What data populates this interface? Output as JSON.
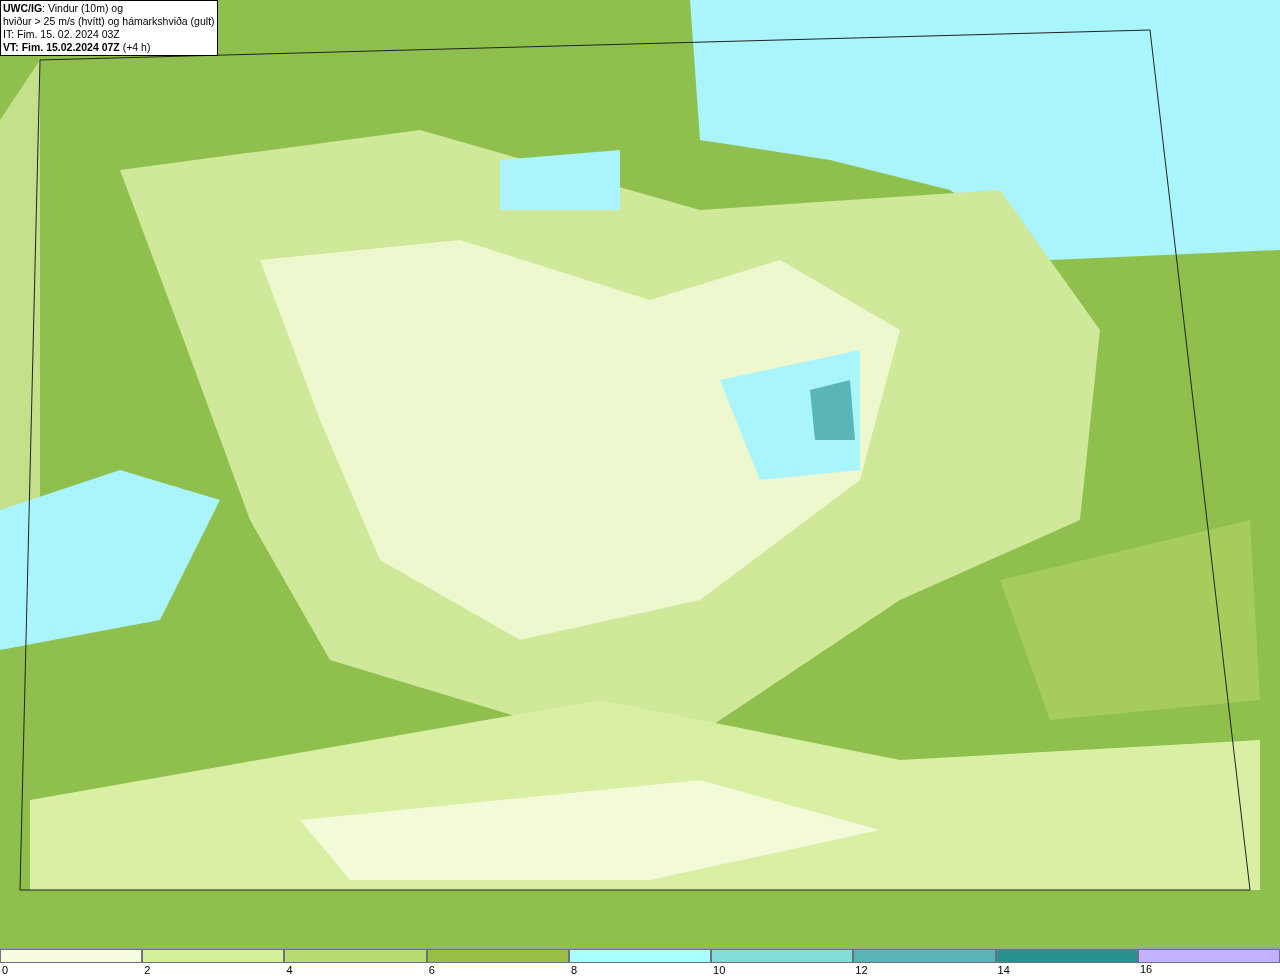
{
  "title_box": {
    "lines": [
      "**UWC/IG**: Vindur (10m) og",
      "hviður > 25 m/s (hvítt) og hámarkshviða (gult)",
      "IT: Fim. 15. 02. 2024 03Z",
      "**VT: Fim. 15.02.2024 07Z** (+4 h)"
    ]
  },
  "legend": {
    "segments": [
      {
        "label": "0",
        "color": "#f7fde0"
      },
      {
        "label": "2",
        "color": "#d6f09a"
      },
      {
        "label": "4",
        "color": "#b8dc72"
      },
      {
        "label": "6",
        "color": "#9abf48"
      },
      {
        "label": "8",
        "color": "#aaffff"
      },
      {
        "label": "10",
        "color": "#82dcd8"
      },
      {
        "label": "12",
        "color": "#5ab6b6"
      },
      {
        "label": "14",
        "color": "#2a928e"
      },
      {
        "color": "#c2b2ff"
      }
    ],
    "end_label": "16"
  }
}
